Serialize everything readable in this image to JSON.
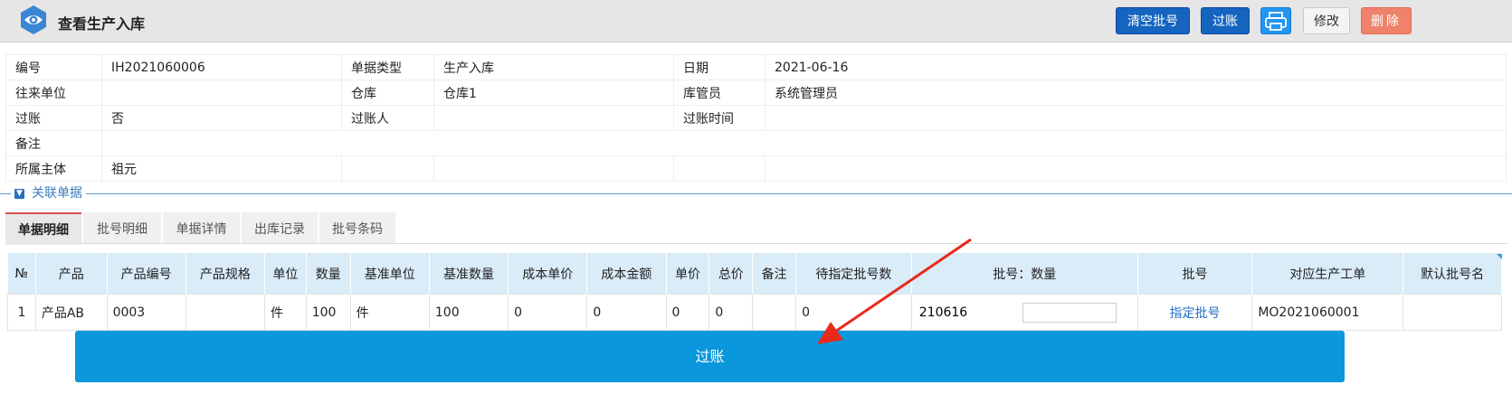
{
  "header": {
    "title": "查看生产入库",
    "buttons": {
      "clear_lot": "清空批号",
      "post": "过账",
      "edit": "修改",
      "delete": "删除"
    }
  },
  "info": {
    "doc_no_label": "编号",
    "doc_no": "IH2021060006",
    "doc_type_label": "单据类型",
    "doc_type": "生产入库",
    "date_label": "日期",
    "date": "2021-06-16",
    "partner_label": "往来单位",
    "partner": "",
    "warehouse_label": "仓库",
    "warehouse": "仓库1",
    "keeper_label": "库管员",
    "keeper": "系统管理员",
    "posted_label": "过账",
    "posted": "否",
    "poster_label": "过账人",
    "poster": "",
    "post_time_label": "过账时间",
    "post_time": "",
    "remark_label": "备注",
    "remark": "",
    "entity_label": "所属主体",
    "entity": "祖元"
  },
  "related": {
    "label": "关联单据"
  },
  "tabs": [
    "单据明细",
    "批号明细",
    "单据详情",
    "出库记录",
    "批号条码"
  ],
  "grid": {
    "headers": [
      "№",
      "产品",
      "产品编号",
      "产品规格",
      "单位",
      "数量",
      "基准单位",
      "基准数量",
      "成本单价",
      "成本金额",
      "单价",
      "总价",
      "备注",
      "待指定批号数",
      "批号：数量",
      "批号",
      "对应生产工单",
      "默认批号名"
    ],
    "row": {
      "no": "1",
      "product": "产品AB",
      "code": "0003",
      "spec": "",
      "unit": "件",
      "qty": "100",
      "base_unit": "件",
      "base_qty": "100",
      "cost_price": "0",
      "cost_amount": "0",
      "price": "0",
      "total": "0",
      "remark": "",
      "pending_lot": "0",
      "lot_value": "210616",
      "lot_qty": "",
      "lot_link": "指定批号",
      "work_order": "MO2021060001",
      "default_lot": ""
    }
  },
  "post_button": "过账",
  "colors": {
    "primary": "#1565c0",
    "post_bar": "#0a97dc",
    "danger": "#f0826b",
    "arrow": "#e8291c"
  },
  "icons": [
    "eye-logo-icon",
    "printer-icon",
    "chevron-down-icon"
  ]
}
